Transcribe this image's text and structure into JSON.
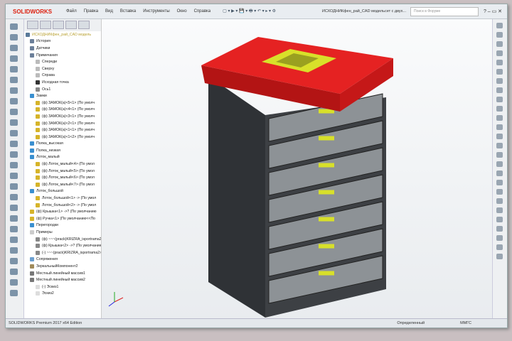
{
  "app": {
    "logo": "SOLIDWORKS",
    "document_title": "ИСХОДНИКфен_рай_CAD модельсет с двух...",
    "search_placeholder": "Поиск в Форуме"
  },
  "menu": [
    "Файл",
    "Правка",
    "Вид",
    "Вставка",
    "Инструменты",
    "Окно",
    "Справка"
  ],
  "tree": {
    "root": "ИСХОДНИКфен_рай_CAD модель",
    "items": [
      {
        "label": "История",
        "depth": 1,
        "color": "#6b7f99"
      },
      {
        "label": "Датчики",
        "depth": 1,
        "color": "#6b7f99"
      },
      {
        "label": "Примечания",
        "depth": 1,
        "color": "#6b7f99"
      },
      {
        "label": "Спереди",
        "depth": 2,
        "color": "#bbb"
      },
      {
        "label": "Сверху",
        "depth": 2,
        "color": "#bbb"
      },
      {
        "label": "Справа",
        "depth": 2,
        "color": "#bbb"
      },
      {
        "label": "Исходная точка",
        "depth": 2,
        "color": "#333"
      },
      {
        "label": "Ось1",
        "depth": 2,
        "color": "#888"
      },
      {
        "label": "Замки",
        "depth": 1,
        "color": "#3a8fd0"
      },
      {
        "label": "(ф) ЗАМОК(а)<5<1> (По умолч",
        "depth": 2,
        "color": "#d6b42a"
      },
      {
        "label": "(ф) ЗАМОК(а)<4<1> (По умолч",
        "depth": 2,
        "color": "#d6b42a"
      },
      {
        "label": "(ф) ЗАМОК(а)<3<1> (По умолч",
        "depth": 2,
        "color": "#d6b42a"
      },
      {
        "label": "(ф) ЗАМОК(а)<2<1> (По умолч",
        "depth": 2,
        "color": "#d6b42a"
      },
      {
        "label": "(ф) ЗАМОК(а)<1<1> (По умолч",
        "depth": 2,
        "color": "#d6b42a"
      },
      {
        "label": "(ф) ЗАМОК(а)<1<2> (По умолч",
        "depth": 2,
        "color": "#d6b42a"
      },
      {
        "label": "Полка_высокая",
        "depth": 1,
        "color": "#3a8fd0"
      },
      {
        "label": "Полка_низкая",
        "depth": 1,
        "color": "#3a8fd0"
      },
      {
        "label": "Лоток_малый",
        "depth": 1,
        "color": "#3a8fd0"
      },
      {
        "label": "(ф) Лоток_малый<4> (По умол",
        "depth": 2,
        "color": "#d6b42a"
      },
      {
        "label": "(ф) Лоток_малый<5> (По умол",
        "depth": 2,
        "color": "#d6b42a"
      },
      {
        "label": "(ф) Лоток_малый<6> (По умол",
        "depth": 2,
        "color": "#d6b42a"
      },
      {
        "label": "(ф) Лоток_малый<7> (По умол",
        "depth": 2,
        "color": "#d6b42a"
      },
      {
        "label": "Лоток_большой",
        "depth": 1,
        "color": "#3a8fd0"
      },
      {
        "label": "Лоток_большой<1> -> (По умол",
        "depth": 2,
        "color": "#d6b42a"
      },
      {
        "label": "Лоток_большой<2> -> (По умол",
        "depth": 2,
        "color": "#d6b42a"
      },
      {
        "label": "(ф) Крышка<1> ->? (По умолчанию",
        "depth": 1,
        "color": "#d6b42a"
      },
      {
        "label": "(ф) Ручка<1> (По умолчанию<<По",
        "depth": 1,
        "color": "#d6b42a"
      },
      {
        "label": "Перегородки",
        "depth": 1,
        "color": "#3a8fd0"
      },
      {
        "label": "Примеры",
        "depth": 1,
        "color": "#ccc"
      },
      {
        "label": "(ф) ~~~(prack)KRIZRA_isportrama2>",
        "depth": 2,
        "color": "#888"
      },
      {
        "label": "(ф) Крышка<2> ->? (По умолчанию",
        "depth": 2,
        "color": "#888"
      },
      {
        "label": "(-) ~~~(prack)KRIZRA_isportrama2>-2",
        "depth": 2,
        "color": "#888"
      },
      {
        "label": "Сопряжения",
        "depth": 1,
        "color": "#6b9fd0"
      },
      {
        "label": "ЗеркальныйКомпонент2",
        "depth": 1,
        "color": "#a08a5a"
      },
      {
        "label": "Местный линейный массив1",
        "depth": 1,
        "color": "#777"
      },
      {
        "label": "Местный линейный массив2",
        "depth": 1,
        "color": "#777"
      },
      {
        "label": "(-) Эскиз1",
        "depth": 2,
        "color": "#ddd"
      },
      {
        "label": "Эскиз2",
        "depth": 2,
        "color": "#ddd"
      }
    ]
  },
  "status": {
    "edition": "SOLIDWORKS Premium 2017 x64 Edition",
    "state": "Определенный",
    "units": "ММГС"
  },
  "colors": {
    "lid": "#d91c1c",
    "body": "#3c3f42",
    "handle": "#d8e02a"
  }
}
